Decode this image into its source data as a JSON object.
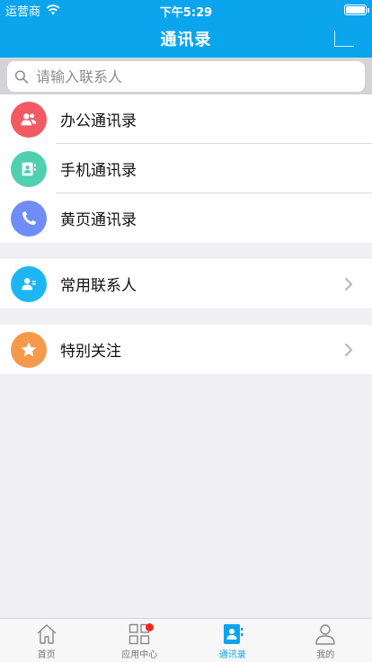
{
  "status_bar": {
    "carrier": "运营商",
    "time": "下午5:29"
  },
  "navbar": {
    "title": "通讯录"
  },
  "search": {
    "placeholder": "请输入联系人"
  },
  "groups": [
    {
      "items": [
        {
          "label": "办公通讯录",
          "icon": "people-icon",
          "color": "#f25a63"
        },
        {
          "label": "手机通讯录",
          "icon": "contact-card-icon",
          "color": "#50d0b0"
        },
        {
          "label": "黄页通讯录",
          "icon": "phone-icon",
          "color": "#6f8cf7"
        }
      ]
    },
    {
      "items": [
        {
          "label": "常用联系人",
          "icon": "frequent-contacts-icon",
          "color": "#1cb7f2"
        }
      ]
    },
    {
      "items": [
        {
          "label": "特别关注",
          "icon": "star-icon",
          "color": "#f59a4d"
        }
      ]
    }
  ],
  "tabbar": {
    "items": [
      {
        "label": "首页",
        "icon": "home-icon"
      },
      {
        "label": "应用中心",
        "icon": "apps-grid-icon"
      },
      {
        "label": "通讯录",
        "icon": "contacts-book-icon",
        "active": true
      },
      {
        "label": "我的",
        "icon": "profile-icon"
      }
    ]
  },
  "colors": {
    "accent": "#0ba5ee",
    "badge": "#ff2222"
  }
}
